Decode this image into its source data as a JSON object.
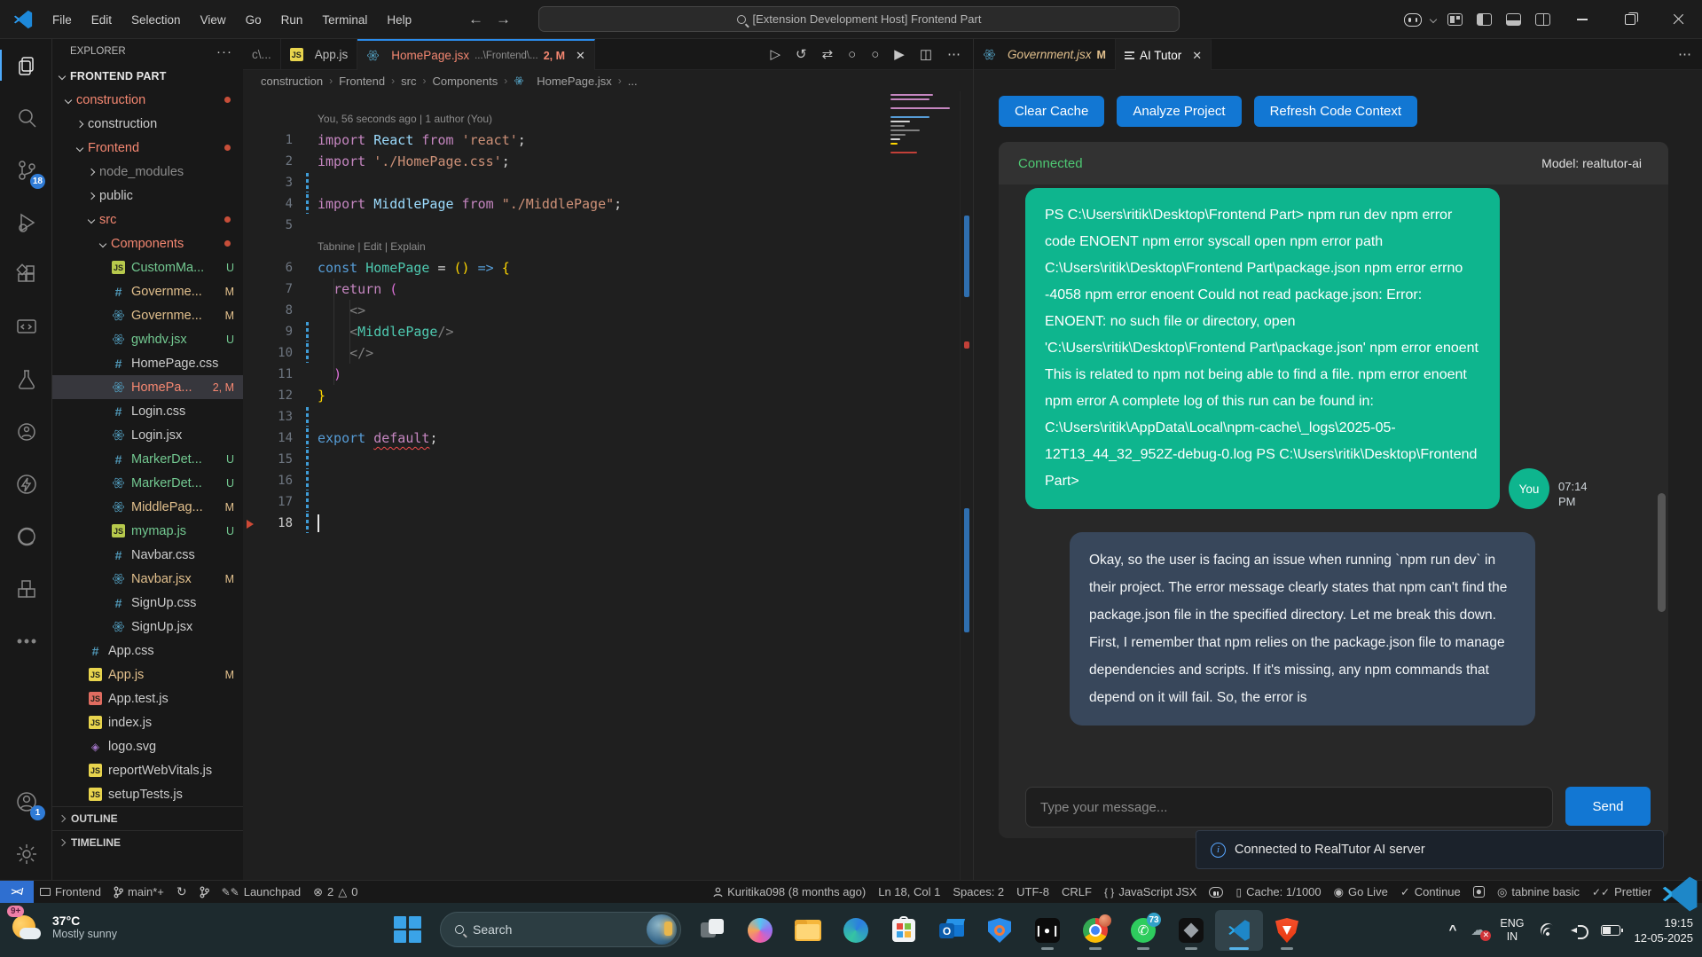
{
  "colors": {
    "accent_blue": "#1277d3",
    "bubble_user": "#0eb58e",
    "bubble_ai": "#38475b",
    "connected_green": "#4ec973",
    "error_red": "#f48771",
    "modified_yellow": "#e2c08d",
    "untracked_green": "#73c991",
    "active_tab_border": "#2b8ceb"
  },
  "titlebar": {
    "menus": [
      "File",
      "Edit",
      "Selection",
      "View",
      "Go",
      "Run",
      "Terminal",
      "Help"
    ],
    "back": "←",
    "forward": "→",
    "command_center": "[Extension Development Host] Frontend Part"
  },
  "activity_bar": {
    "top": [
      {
        "name": "explorer-icon",
        "active": true
      },
      {
        "name": "search-icon"
      },
      {
        "name": "source-control-icon",
        "badge": "18"
      },
      {
        "name": "run-debug-icon"
      },
      {
        "name": "extensions-icon"
      },
      {
        "name": "remote-explorer-icon"
      },
      {
        "name": "testing-icon"
      },
      {
        "name": "live-share-icon"
      },
      {
        "name": "thunder-client-icon"
      },
      {
        "name": "browser-preview-icon"
      },
      {
        "name": "project-manager-icon"
      },
      {
        "name": "more-tools-icon"
      }
    ],
    "bottom": [
      {
        "name": "accounts-icon",
        "badge": "1"
      },
      {
        "name": "settings-gear-icon"
      }
    ]
  },
  "explorer": {
    "title": "EXPLORER",
    "more": "···",
    "root": "FRONTEND PART",
    "items": [
      {
        "label": "construction",
        "indent": 1,
        "chev": "down",
        "color": "#f48771",
        "dot": "#c74e39"
      },
      {
        "label": "construction",
        "indent": 2,
        "chev": "right",
        "color": "#cccccc"
      },
      {
        "label": "Frontend",
        "indent": 2,
        "chev": "down",
        "color": "#f48771",
        "dot": "#c74e39"
      },
      {
        "label": "node_modules",
        "indent": 3,
        "chev": "right",
        "color": "#8c8c8c"
      },
      {
        "label": "public",
        "indent": 3,
        "chev": "right",
        "color": "#cccccc"
      },
      {
        "label": "src",
        "indent": 3,
        "chev": "down",
        "color": "#f48771",
        "dot": "#c74e39"
      },
      {
        "label": "Components",
        "indent": 4,
        "chev": "down",
        "color": "#f48771",
        "dot": "#c74e39"
      },
      {
        "label": "CustomMa...",
        "indent": 5,
        "icon": "js-green",
        "color": "#73c991",
        "badge": "U"
      },
      {
        "label": "Governme...",
        "indent": 5,
        "icon": "css",
        "color": "#e2c08d",
        "badge": "M"
      },
      {
        "label": "Governme...",
        "indent": 5,
        "icon": "react",
        "color": "#e2c08d",
        "badge": "M"
      },
      {
        "label": "gwhdv.jsx",
        "indent": 5,
        "icon": "react",
        "color": "#73c991",
        "badge": "U"
      },
      {
        "label": "HomePage.css",
        "indent": 5,
        "icon": "css",
        "color": "#cccccc"
      },
      {
        "label": "HomePa...",
        "indent": 5,
        "icon": "react",
        "color": "#f48771",
        "badge": "2, M",
        "selected": true
      },
      {
        "label": "Login.css",
        "indent": 5,
        "icon": "css",
        "color": "#cccccc"
      },
      {
        "label": "Login.jsx",
        "indent": 5,
        "icon": "react",
        "color": "#cccccc"
      },
      {
        "label": "MarkerDet...",
        "indent": 5,
        "icon": "css",
        "color": "#73c991",
        "badge": "U"
      },
      {
        "label": "MarkerDet...",
        "indent": 5,
        "icon": "react",
        "color": "#73c991",
        "badge": "U"
      },
      {
        "label": "MiddlePag...",
        "indent": 5,
        "icon": "react",
        "color": "#e2c08d",
        "badge": "M"
      },
      {
        "label": "mymap.js",
        "indent": 5,
        "icon": "js-green",
        "color": "#73c991",
        "badge": "U"
      },
      {
        "label": "Navbar.css",
        "indent": 5,
        "icon": "css",
        "color": "#cccccc"
      },
      {
        "label": "Navbar.jsx",
        "indent": 5,
        "icon": "react",
        "color": "#e2c08d",
        "badge": "M"
      },
      {
        "label": "SignUp.css",
        "indent": 5,
        "icon": "css",
        "color": "#cccccc"
      },
      {
        "label": "SignUp.jsx",
        "indent": 5,
        "icon": "react",
        "color": "#cccccc"
      },
      {
        "label": "App.css",
        "indent": 3,
        "icon": "css",
        "color": "#cccccc"
      },
      {
        "label": "App.js",
        "indent": 3,
        "icon": "js-yellow",
        "color": "#e2c08d",
        "badge": "M"
      },
      {
        "label": "App.test.js",
        "indent": 3,
        "icon": "js-red",
        "color": "#cccccc"
      },
      {
        "label": "index.js",
        "indent": 3,
        "icon": "js-yellow",
        "color": "#cccccc"
      },
      {
        "label": "logo.svg",
        "indent": 3,
        "icon": "svg",
        "color": "#cccccc"
      },
      {
        "label": "reportWebVitals.js",
        "indent": 3,
        "icon": "js-yellow",
        "color": "#cccccc"
      },
      {
        "label": "setupTests.js",
        "indent": 3,
        "icon": "js-yellow",
        "color": "#cccccc"
      }
    ],
    "sections": [
      "OUTLINE",
      "TIMELINE"
    ]
  },
  "editor": {
    "stub_tab": "c\\...",
    "tab_appjs": "App.js",
    "active_tab": {
      "name": "HomePage.jsx",
      "desc": "...\\Frontend\\...",
      "badge": "2, M",
      "close": "✕"
    },
    "actions": [
      "▷",
      "↺",
      "⇄",
      "○",
      "○",
      "▶",
      "◫",
      "⋯"
    ],
    "breadcrumb": [
      "construction",
      "Frontend",
      "src",
      "Components",
      "HomePage.jsx",
      "..."
    ],
    "codelens_top": "You, 56 seconds ago | 1 author (You)",
    "codelens_mid": "Tabnine | Edit | Explain",
    "lines": [
      {
        "n": 1,
        "t": [
          [
            "kw",
            "import "
          ],
          [
            "id",
            "React"
          ],
          [
            "kw",
            " from "
          ],
          [
            "st",
            "'react'"
          ],
          [
            "pn",
            ";"
          ]
        ]
      },
      {
        "n": 2,
        "t": [
          [
            "kw",
            "import "
          ],
          [
            "st",
            "'./HomePage.css'"
          ],
          [
            "pn",
            ";"
          ]
        ]
      },
      {
        "n": 3,
        "t": [],
        "mod": true
      },
      {
        "n": 4,
        "t": [
          [
            "kw",
            "import "
          ],
          [
            "id",
            "MiddlePage"
          ],
          [
            "kw",
            " from "
          ],
          [
            "st",
            "\"./MiddlePage\""
          ],
          [
            "pn",
            ";"
          ]
        ],
        "mod": true
      },
      {
        "n": 5,
        "t": []
      },
      {
        "n": 6,
        "t": [
          [
            "kb",
            "const "
          ],
          [
            "cp",
            "HomePage"
          ],
          [
            "pn",
            " = "
          ],
          [
            "b1",
            "()"
          ],
          [
            "kb",
            " => "
          ],
          [
            "b1",
            "{"
          ]
        ],
        "lens_before": true
      },
      {
        "n": 7,
        "t": [
          [
            "pn",
            "  "
          ],
          [
            "kw",
            "return"
          ],
          [
            "pn",
            " "
          ],
          [
            "b2",
            "("
          ]
        ]
      },
      {
        "n": 8,
        "t": [
          [
            "tg",
            "    <>"
          ]
        ]
      },
      {
        "n": 9,
        "t": [
          [
            "tg",
            "    <"
          ],
          [
            "cp",
            "MiddlePage"
          ],
          [
            "tg",
            "/>"
          ]
        ],
        "mod": true
      },
      {
        "n": 10,
        "t": [
          [
            "tg",
            "    </>"
          ]
        ],
        "mod": true
      },
      {
        "n": 11,
        "t": [
          [
            "pn",
            "  "
          ],
          [
            "b2",
            ")"
          ]
        ]
      },
      {
        "n": 12,
        "t": [
          [
            "b1",
            "}"
          ]
        ]
      },
      {
        "n": 13,
        "t": [],
        "mod": true
      },
      {
        "n": 14,
        "t": [
          [
            "kb",
            "export "
          ],
          [
            "er",
            "default"
          ],
          [
            "pn",
            ";"
          ]
        ],
        "mod": true
      },
      {
        "n": 15,
        "t": [],
        "mod": true
      },
      {
        "n": 16,
        "t": [],
        "mod": true
      },
      {
        "n": 17,
        "t": [],
        "mod": true
      },
      {
        "n": 18,
        "t": [],
        "mod": true,
        "cursor": true,
        "errmark": true
      }
    ],
    "token_colors": {
      "kw": "#c586c0",
      "kb": "#569cd6",
      "id": "#9cdcfe",
      "cp": "#4ec9b0",
      "st": "#ce9178",
      "pn": "#d4d4d4",
      "b1": "#ffd700",
      "b2": "#da70d6",
      "tg": "#808080",
      "er": "#c586c0"
    }
  },
  "panel": {
    "preview_tab": {
      "name": "Government.jsx",
      "badge": "M"
    },
    "active_tab": {
      "name": "AI Tutor",
      "close": "✕"
    },
    "more": "⋯",
    "buttons": [
      "Clear Cache",
      "Analyze Project",
      "Refresh Code Context"
    ],
    "status": "Connected",
    "model": "Model: realtutor-ai",
    "user_message": "PS C:\\Users\\ritik\\Desktop\\Frontend Part> npm run dev npm error code ENOENT npm error syscall open npm error path C:\\Users\\ritik\\Desktop\\Frontend Part\\package.json npm error errno -4058 npm error enoent Could not read package.json: Error: ENOENT: no such file or directory, open 'C:\\Users\\ritik\\Desktop\\Frontend Part\\package.json' npm error enoent This is related to npm not being able to find a file. npm error enoent npm error A complete log of this run can be found in: C:\\Users\\ritik\\AppData\\Local\\npm-cache\\_logs\\2025-05-12T13_44_32_952Z-debug-0.log PS C:\\Users\\ritik\\Desktop\\Frontend Part>",
    "user_label": "You",
    "user_time_1": "07:14",
    "user_time_2": "PM",
    "ai_message": "Okay, so the user is facing an issue when running `npm run dev` in their project. The error message clearly states that npm can't find the package.json file in the specified directory. Let me break this down. First, I remember that npm relies on the package.json file to manage dependencies and scripts. If it's missing, any npm commands that depend on it will fail. So, the error is",
    "input_placeholder": "Type your message...",
    "send_label": "Send",
    "toast": "Connected to RealTutor AI server"
  },
  "status_bar": {
    "remote": "></",
    "left": [
      {
        "name": "workspace-item",
        "icon": "monitor",
        "text": "Frontend"
      },
      {
        "name": "branch-item",
        "icon": "branch",
        "text": "main*+"
      },
      {
        "name": "sync-item",
        "icon": "sync",
        "text": ""
      },
      {
        "name": "compare-item",
        "icon": "branch",
        "text": ""
      },
      {
        "name": "launchpad-item",
        "icon": "pens",
        "text": "Launchpad"
      },
      {
        "name": "problems-item",
        "icon": "problems",
        "text": "2",
        "text2": "0"
      }
    ],
    "right": [
      {
        "name": "blame-item",
        "icon": "person",
        "text": "Kuritika098 (8 months ago)"
      },
      {
        "name": "cursor-position",
        "text": "Ln 18, Col 1"
      },
      {
        "name": "indentation",
        "text": "Spaces: 2"
      },
      {
        "name": "encoding",
        "text": "UTF-8"
      },
      {
        "name": "eol",
        "text": "CRLF"
      },
      {
        "name": "language-mode",
        "icon": "braces",
        "text": "JavaScript JSX"
      },
      {
        "name": "copilot-status",
        "icon": "copilot",
        "text": ""
      },
      {
        "name": "cache-item",
        "icon": "cache",
        "text": "Cache: 1/1000"
      },
      {
        "name": "go-live",
        "icon": "golive",
        "text": "Go Live"
      },
      {
        "name": "continue-item",
        "icon": "check",
        "text": "Continue"
      },
      {
        "name": "robot-item",
        "icon": "robot",
        "text": ""
      },
      {
        "name": "tabnine-item",
        "icon": "tabnine",
        "text": "tabnine basic"
      },
      {
        "name": "prettier-item",
        "icon": "dblcheck",
        "text": "Prettier"
      }
    ]
  },
  "taskbar": {
    "weather": {
      "temp": "37°C",
      "cond": "Mostly sunny",
      "badge": "9+"
    },
    "search_placeholder": "Search",
    "icons": [
      {
        "name": "task-view-icon"
      },
      {
        "name": "copilot-app-icon"
      },
      {
        "name": "file-explorer-icon"
      },
      {
        "name": "edge-icon"
      },
      {
        "name": "ms-store-icon"
      },
      {
        "name": "outlook-icon"
      },
      {
        "name": "hotspot-shield-icon"
      },
      {
        "name": "media-app-icon",
        "running": true
      },
      {
        "name": "chrome-icon",
        "running": true,
        "avatar_badge": true
      },
      {
        "name": "whatsapp-icon",
        "running": true,
        "badge": "73"
      },
      {
        "name": "cube-app-icon",
        "running": true
      },
      {
        "name": "vscode-icon",
        "running": true,
        "active": true
      },
      {
        "name": "brave-icon",
        "running": true
      }
    ],
    "tray": {
      "chevron": "^",
      "lang_top": "ENG",
      "lang_bottom": "IN",
      "time": "19:15",
      "date": "12-05-2025"
    }
  }
}
